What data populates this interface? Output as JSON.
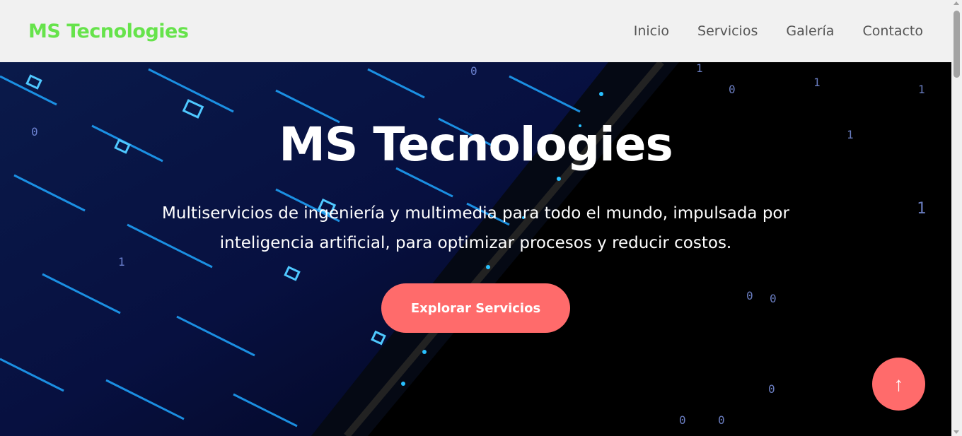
{
  "navbar": {
    "logo": "MS Tecnologies",
    "links": [
      "Inicio",
      "Servicios",
      "Galería",
      "Contacto"
    ]
  },
  "hero": {
    "title": "MS Tecnologies",
    "subtitle": "Multiservicios de ingeniería y multimedia para todo el mundo, impulsada por inteligencia artificial, para optimizar procesos y reducir costos.",
    "cta_label": "Explorar Servicios"
  },
  "scroll_top": {
    "icon": "↑"
  },
  "colors": {
    "logo": "#66e34b",
    "accent": "#ff6b6b",
    "navbar_bg": "#f1f1f1",
    "nav_link": "#555555"
  }
}
